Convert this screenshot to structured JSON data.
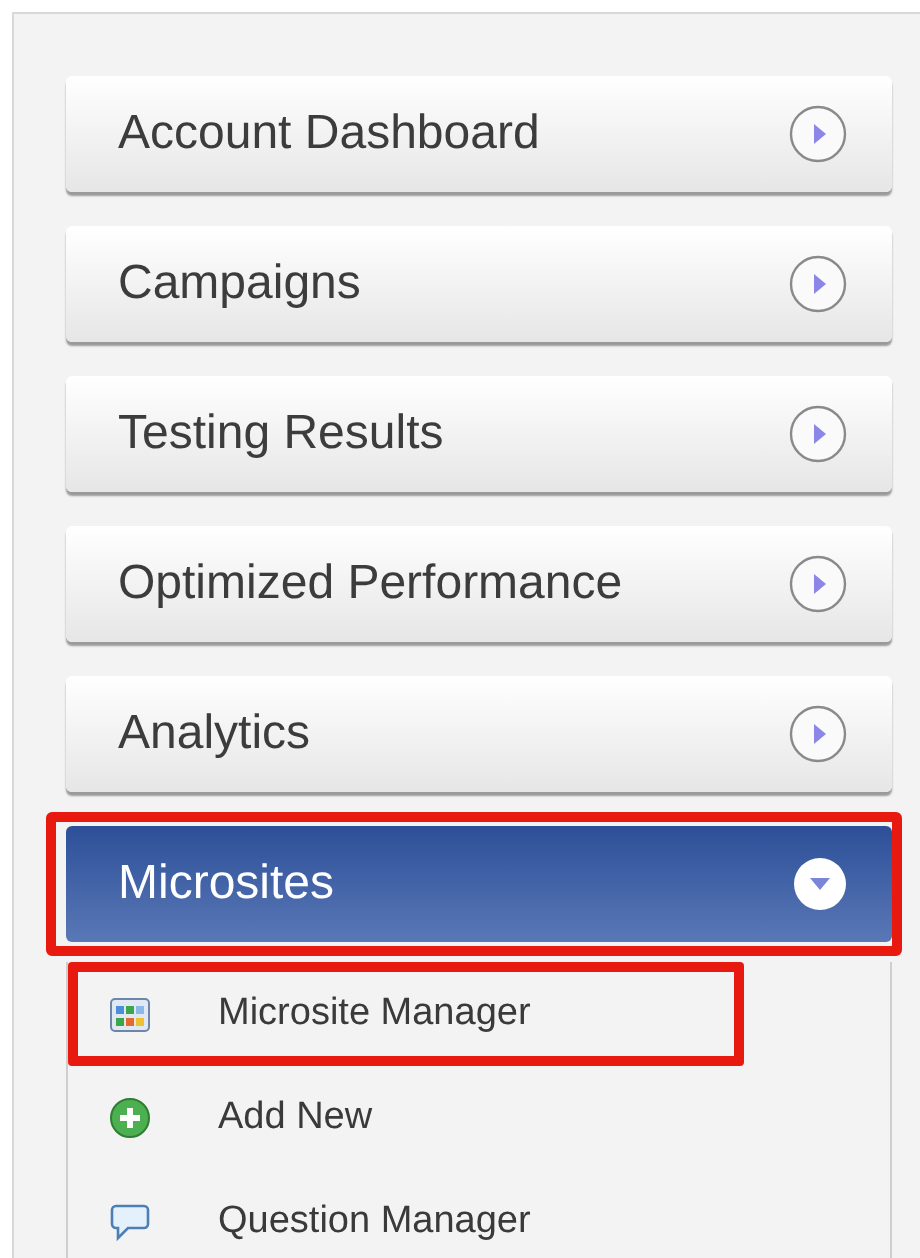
{
  "menu": [
    {
      "label": "Account Dashboard",
      "expanded": false,
      "highlighted": false
    },
    {
      "label": "Campaigns",
      "expanded": false,
      "highlighted": false
    },
    {
      "label": "Testing Results",
      "expanded": false,
      "highlighted": false
    },
    {
      "label": "Optimized Performance",
      "expanded": false,
      "highlighted": false
    },
    {
      "label": "Analytics",
      "expanded": false,
      "highlighted": false
    },
    {
      "label": "Microsites",
      "expanded": true,
      "highlighted": true,
      "children": [
        {
          "label": "Microsite Manager",
          "kind": "grid",
          "highlighted": true
        },
        {
          "label": "Add New",
          "kind": "add",
          "highlighted": false
        },
        {
          "label": "Question Manager",
          "kind": "speech",
          "highlighted": false
        }
      ]
    }
  ]
}
